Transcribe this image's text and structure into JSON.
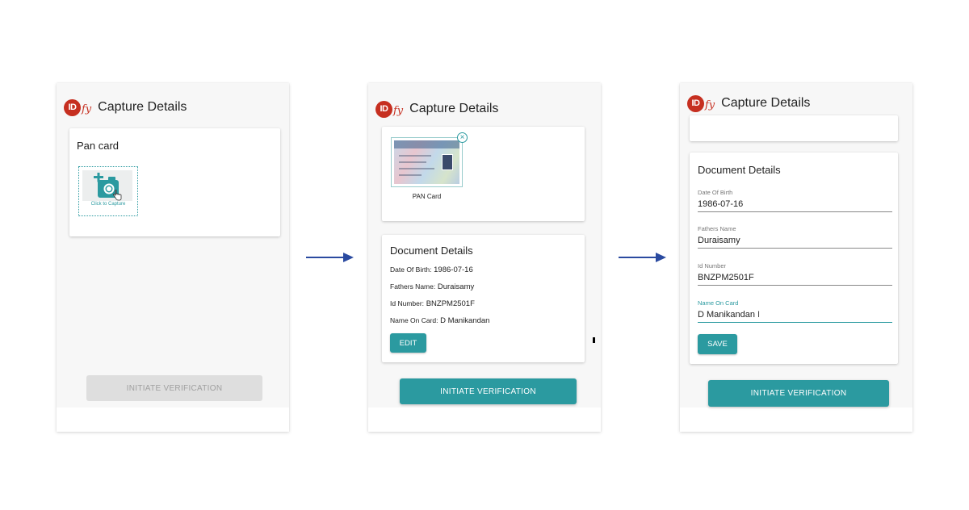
{
  "brand": {
    "logo_text": "ID",
    "logo_suffix": "fy",
    "color": "#c62f20"
  },
  "accent_color": "#2b9aa0",
  "screens": [
    {
      "header_title": "Capture Details",
      "card_label": "Pan card",
      "capture_text": "Click to Capture",
      "button_label": "INITIATE VERIFICATION",
      "button_state": "disabled"
    },
    {
      "header_title": "Capture Details",
      "thumb_caption": "PAN Card",
      "doc_title": "Document Details",
      "rows": [
        {
          "key": "Date Of Birth:",
          "value": "1986-07-16"
        },
        {
          "key": "Fathers Name:",
          "value": "Duraisamy"
        },
        {
          "key": "Id Number:",
          "value": "BNZPM2501F"
        },
        {
          "key": "Name On Card:",
          "value": "D Manikandan"
        }
      ],
      "edit_label": "EDIT",
      "button_label": "INITIATE VERIFICATION"
    },
    {
      "header_title": "Capture Details",
      "doc_title": "Document Details",
      "fields": [
        {
          "label": "Date Of Birth",
          "value": "1986-07-16"
        },
        {
          "label": "Fathers Name",
          "value": "Duraisamy"
        },
        {
          "label": "Id Number",
          "value": "BNZPM2501F"
        },
        {
          "label": "Name On Card",
          "value": "D Manikandan"
        }
      ],
      "save_label": "SAVE",
      "button_label": "INITIATE VERIFICATION"
    }
  ],
  "icons": [
    "camera-plus-icon",
    "hand-pointer-icon",
    "close-icon",
    "arrow-right-icon",
    "text-cursor-icon"
  ]
}
